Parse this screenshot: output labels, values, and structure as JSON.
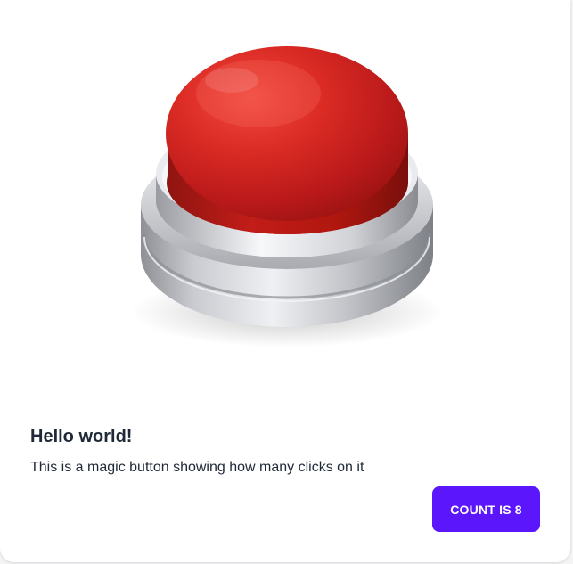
{
  "card": {
    "title": "Hello world!",
    "description": "This is a magic button showing how many clicks on it"
  },
  "count_button": {
    "label": "Count is",
    "count": "8",
    "background_color": "#5b16fb",
    "text_color": "#ffffff"
  },
  "image": {
    "subject": "red-push-button-icon",
    "button_color": "#d42a24",
    "base_color": "#b9bbc0"
  }
}
